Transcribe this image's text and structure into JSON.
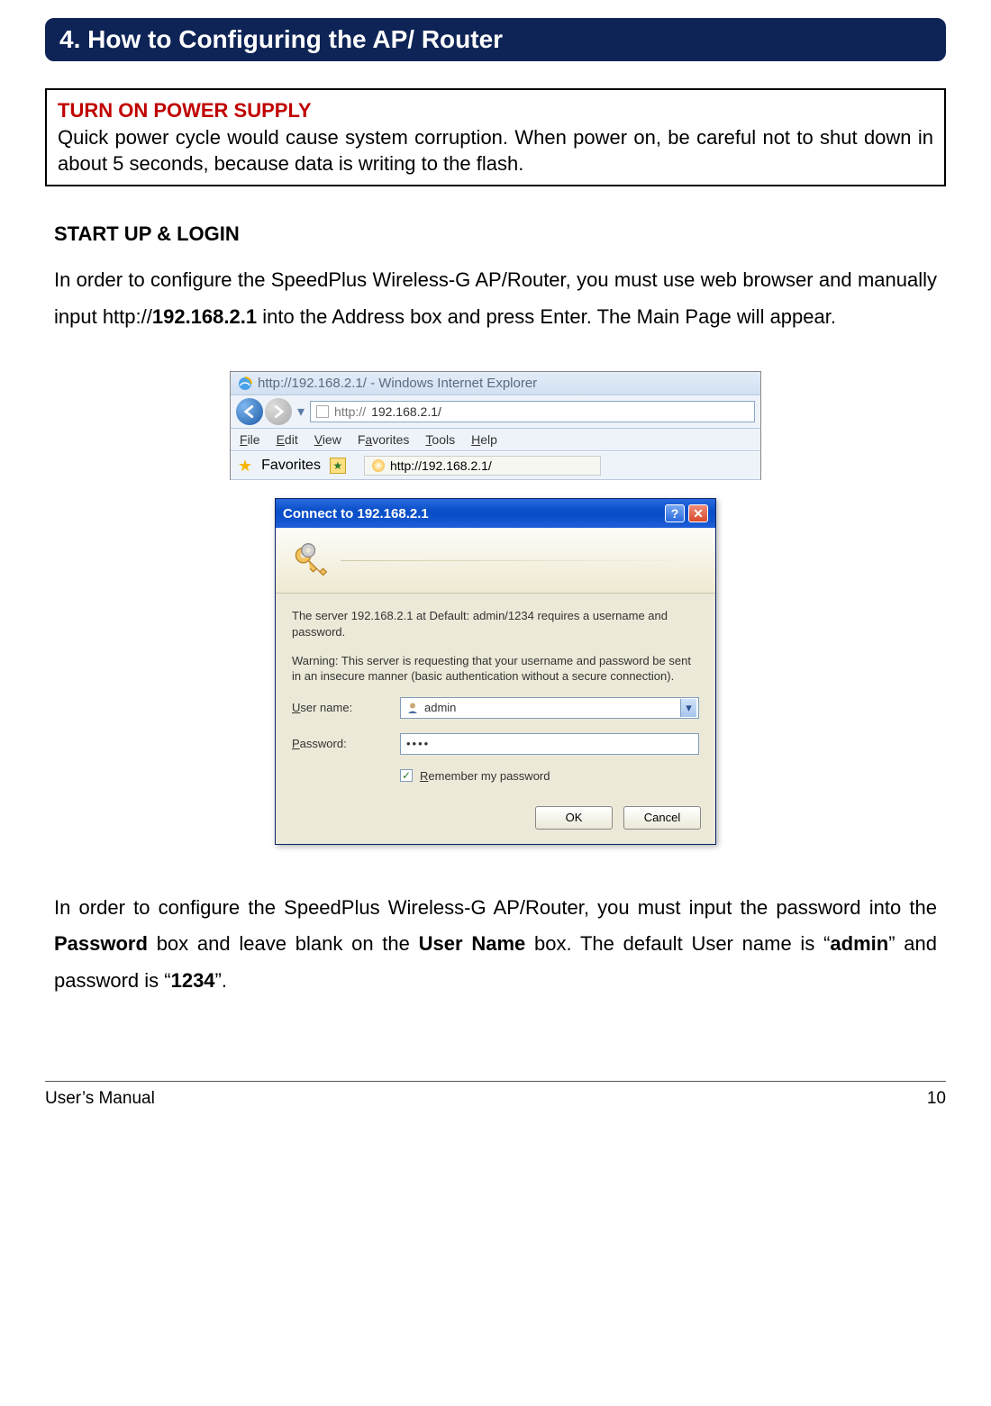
{
  "section_title": "4. How to Configuring the AP/ Router",
  "warning": {
    "title": "TURN ON POWER SUPPLY",
    "body": "Quick power cycle would cause system corruption. When power on, be careful not to shut down in about 5 seconds, because data is writing to the flash."
  },
  "subhead": "START UP & LOGIN",
  "para1_a": "In order to configure the SpeedPlus Wireless-G AP/Router, you must use web browser and manually input http://",
  "para1_bold_ip": "192.168.2.1",
  "para1_b": " into the Address box and press Enter. The Main Page will appear.",
  "browser": {
    "window_title": "http://192.168.2.1/ - Windows Internet Explorer",
    "address_prefix": "http://",
    "address_value": "192.168.2.1/",
    "menu": {
      "file": "File",
      "edit": "Edit",
      "view": "View",
      "favorites": "Favorites",
      "tools": "Tools",
      "help": "Help"
    },
    "favorites_label": "Favorites",
    "tab_label": "http://192.168.2.1/"
  },
  "dialog": {
    "title": "Connect to 192.168.2.1",
    "msg1": "The server 192.168.2.1 at Default: admin/1234 requires a username and password.",
    "msg2": "Warning: This server is requesting that your username and password be sent in an insecure manner (basic authentication without a secure connection).",
    "username_label": "User name:",
    "username_value": "admin",
    "password_label": "Password:",
    "password_masked": "••••",
    "remember_label": "Remember my password",
    "ok": "OK",
    "cancel": "Cancel"
  },
  "para2_a": "In order to configure the SpeedPlus Wireless-G AP/Router, you must input the password into the ",
  "para2_bold1": "Password",
  "para2_b": " box and leave blank on the ",
  "para2_bold2": "User Name",
  "para2_c": " box. The default User name is “",
  "para2_bold3": "admin",
  "para2_d": "” and password is “",
  "para2_bold4": "1234",
  "para2_e": "”.",
  "footer": {
    "left": "User’s Manual",
    "right": "10"
  }
}
